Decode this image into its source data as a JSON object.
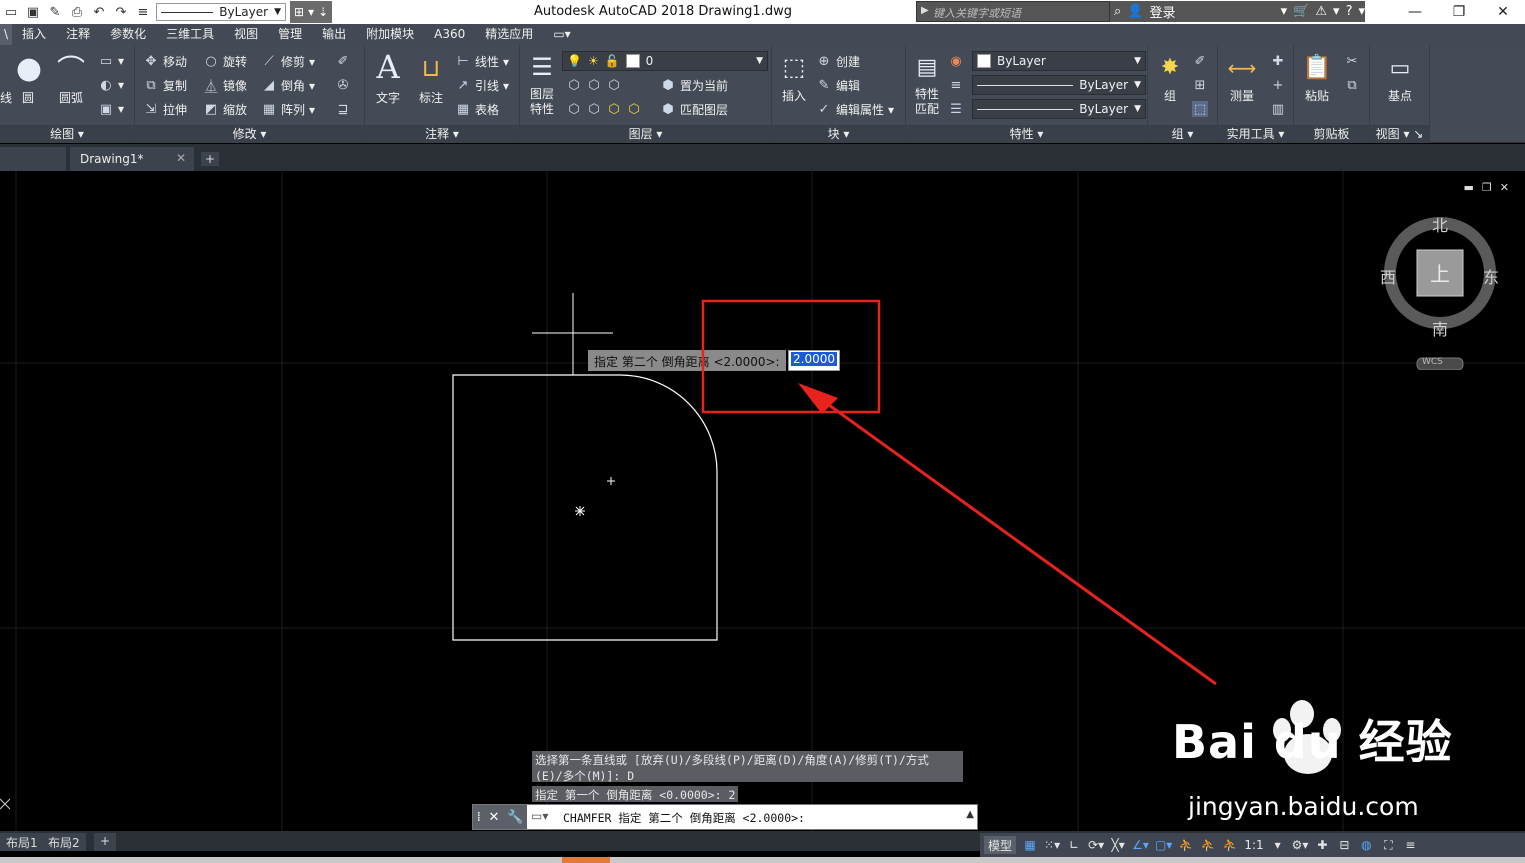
{
  "window": {
    "app_title": "Autodesk AutoCAD 2018    Drawing1.dwg",
    "search_placeholder": "键入关键字或短语",
    "login_label": "登录",
    "layer_combo": "ByLayer"
  },
  "tabs": [
    "插入",
    "注释",
    "参数化",
    "三维工具",
    "视图",
    "管理",
    "输出",
    "附加模块",
    "A360",
    "精选应用"
  ],
  "ribbon": {
    "draw": {
      "title": "绘图",
      "circle": "圆",
      "arc": "圆弧",
      "line_partial": "线"
    },
    "modify": {
      "title": "修改",
      "move": "移动",
      "rotate": "旋转",
      "trim": "修剪",
      "copy": "复制",
      "mirror": "镜像",
      "fillet": "倒角",
      "stretch": "拉伸",
      "scale": "缩放",
      "array": "阵列"
    },
    "annotation": {
      "title": "注释",
      "text": "文字",
      "dimension": "标注",
      "linear": "线性",
      "leader": "引线",
      "table": "表格"
    },
    "layers": {
      "title": "图层",
      "layer_props": "图层\n特性",
      "current_layer": "0",
      "make_current": "置为当前",
      "match_layer": "匹配图层"
    },
    "block": {
      "title": "块",
      "insert": "插入",
      "create": "创建",
      "edit": "编辑",
      "edit_attr": "编辑属性"
    },
    "properties": {
      "title": "特性",
      "match": "特性\n匹配",
      "color": "ByLayer",
      "linetype": "ByLayer",
      "lineweight": "ByLayer"
    },
    "groups": {
      "title": "组",
      "group": "组"
    },
    "utilities": {
      "title": "实用工具",
      "measure": "测量"
    },
    "clipboard": {
      "title": "剪贴板",
      "paste": "粘贴"
    },
    "view": {
      "title": "视图",
      "base": "基点"
    }
  },
  "file_tab": {
    "name": "Drawing1*"
  },
  "viewcube": {
    "north": "北",
    "south": "南",
    "east": "东",
    "west": "西",
    "top": "上",
    "wcs": "WCS"
  },
  "dynamic_input": {
    "prompt": "指定 第二个 倒角距离 <2.0000>:",
    "value": "2.0000"
  },
  "command": {
    "history_1a": "选择第一条直线或 [放弃(U)/多段线(P)/距离(D)/角度(A)/修剪(T)/方式",
    "history_1b": "(E)/多个(M)]:  D",
    "history_2": "指定 第一个 倒角距离 <0.0000>: 2",
    "current": "CHAMFER 指定 第二个 倒角距离 <2.0000>:"
  },
  "layout_tabs": [
    "布局1",
    "布局2"
  ],
  "status": {
    "model": "模型",
    "scale": "1:1"
  },
  "watermark": {
    "brand": "Bai du 经验",
    "url": "jingyan.baidu.com"
  },
  "colors": {
    "ribbon": "#444b56",
    "highlight": "#1b5bd6",
    "annotation_red": "#e8231e"
  }
}
